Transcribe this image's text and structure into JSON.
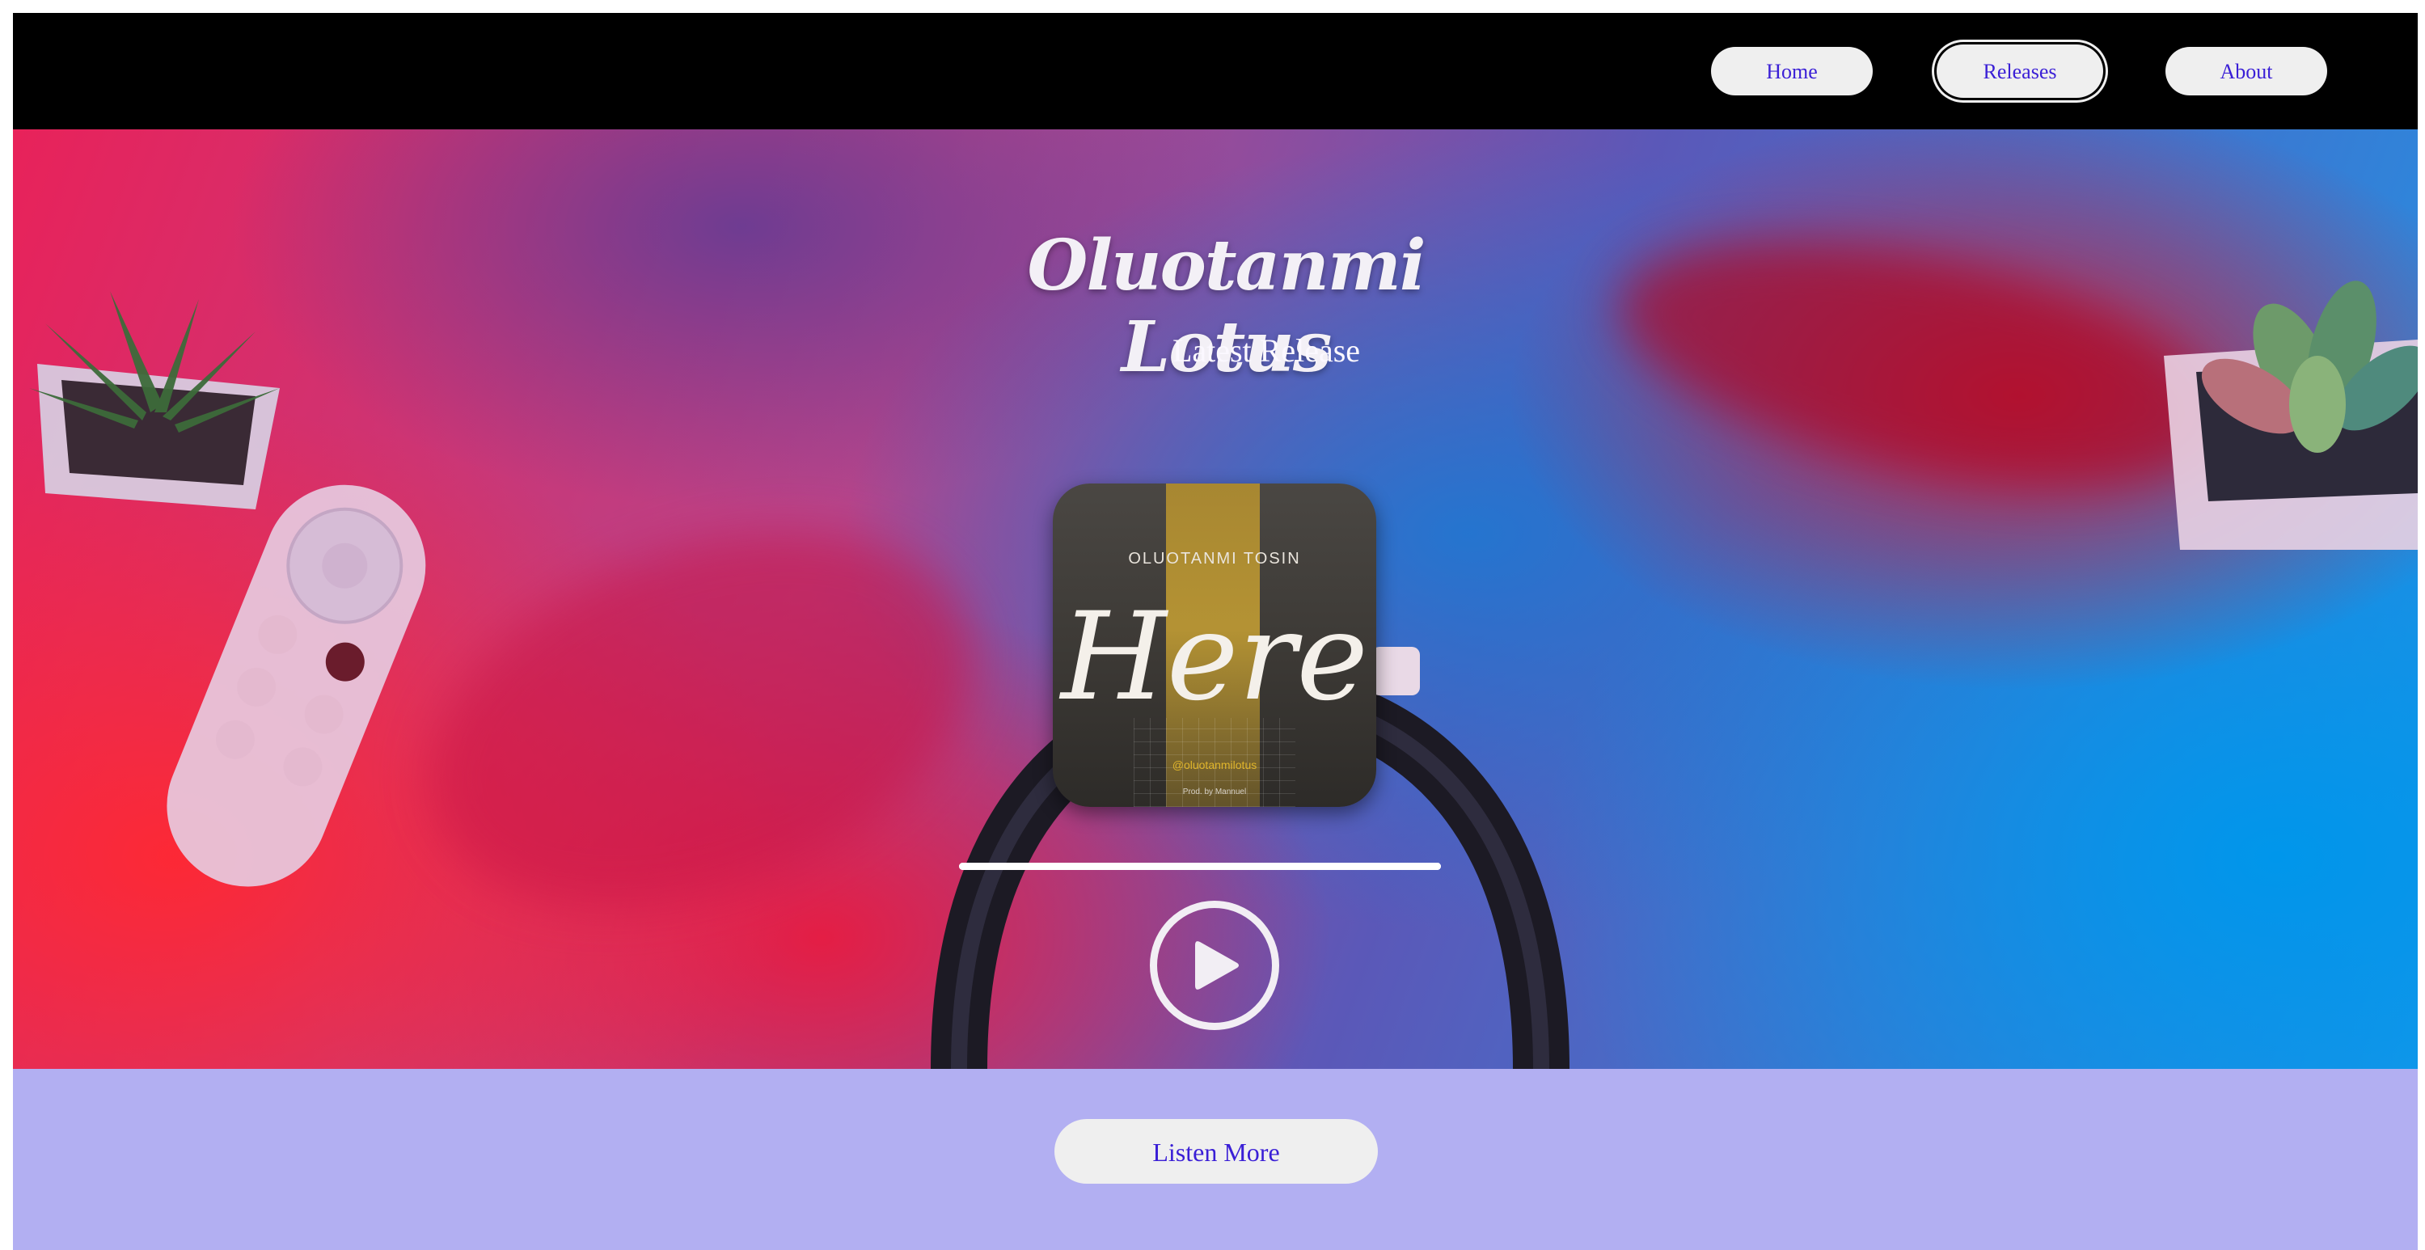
{
  "nav": {
    "items": [
      {
        "label": "Home",
        "active": false
      },
      {
        "label": "Releases",
        "active": true
      },
      {
        "label": "About",
        "active": false
      }
    ]
  },
  "hero": {
    "title": "Oluotanmi Lotus",
    "subtitle": "Latest Release",
    "album": {
      "artist": "OLUOTANMI TOSIN",
      "song": "Here",
      "socials": "@oluotanmilotus",
      "producer": "Prod. by Mannuel"
    },
    "player": {
      "progress": 1.0,
      "play_icon": "play-icon"
    }
  },
  "cta": {
    "label": "Listen More"
  },
  "colors": {
    "nav_background": "#000000",
    "button_background": "#efefef",
    "button_text": "#3a1fd6",
    "band_background": "#b2aff2"
  }
}
